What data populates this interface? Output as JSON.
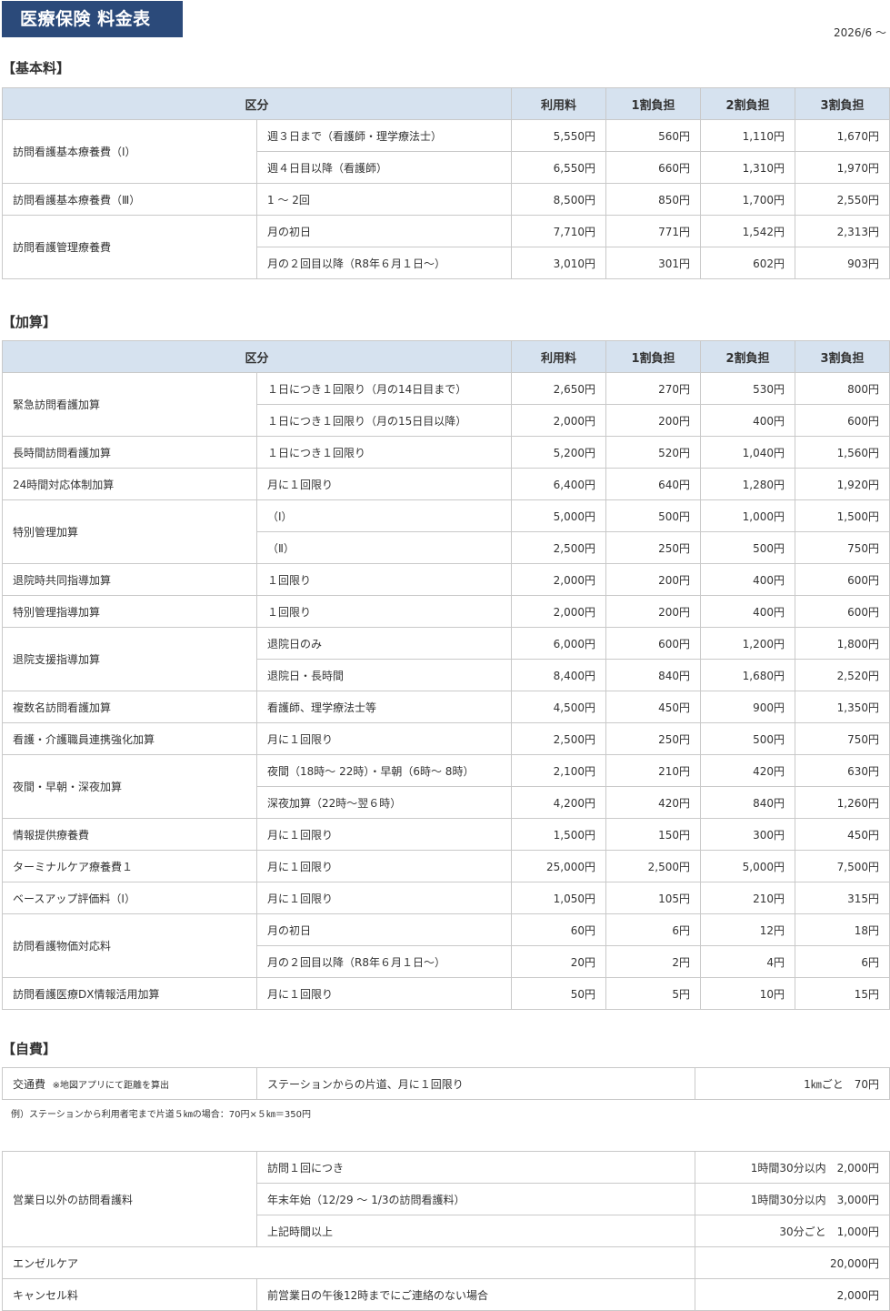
{
  "header": {
    "title": "医療保険 料金表",
    "date": "2026/6 〜"
  },
  "basic": {
    "section_title": "【基本料】",
    "headers": [
      "区分",
      "利用料",
      "1割負担",
      "2割負担",
      "3割負担"
    ],
    "groups": [
      {
        "name": "訪問看護基本療養費（Ⅰ）",
        "rows": [
          {
            "desc": "週３日まで（看護師・理学療法士）",
            "vals": [
              "5,550円",
              "560円",
              "1,110円",
              "1,670円"
            ]
          },
          {
            "desc": "週４日目以降（看護師）",
            "vals": [
              "6,550円",
              "660円",
              "1,310円",
              "1,970円"
            ]
          }
        ]
      },
      {
        "name": "訪問看護基本療養費（Ⅲ）",
        "rows": [
          {
            "desc": "1 〜 2回",
            "vals": [
              "8,500円",
              "850円",
              "1,700円",
              "2,550円"
            ]
          }
        ]
      },
      {
        "name": "訪問看護管理療養費",
        "rows": [
          {
            "desc": "月の初日",
            "vals": [
              "7,710円",
              "771円",
              "1,542円",
              "2,313円"
            ]
          },
          {
            "desc": "月の２回目以降（R8年６月１日〜）",
            "vals": [
              "3,010円",
              "301円",
              "602円",
              "903円"
            ]
          }
        ]
      }
    ]
  },
  "addition": {
    "section_title": "【加算】",
    "headers": [
      "区分",
      "利用料",
      "1割負担",
      "2割負担",
      "3割負担"
    ],
    "groups": [
      {
        "name": "緊急訪問看護加算",
        "rows": [
          {
            "desc": "１日につき１回限り（月の14日目まで）",
            "vals": [
              "2,650円",
              "270円",
              "530円",
              "800円"
            ]
          },
          {
            "desc": "１日につき１回限り（月の15日目以降）",
            "vals": [
              "2,000円",
              "200円",
              "400円",
              "600円"
            ]
          }
        ]
      },
      {
        "name": "長時間訪問看護加算",
        "rows": [
          {
            "desc": "１日につき１回限り",
            "vals": [
              "5,200円",
              "520円",
              "1,040円",
              "1,560円"
            ]
          }
        ]
      },
      {
        "name": "24時間対応体制加算",
        "rows": [
          {
            "desc": "月に１回限り",
            "vals": [
              "6,400円",
              "640円",
              "1,280円",
              "1,920円"
            ]
          }
        ]
      },
      {
        "name": "特別管理加算",
        "rows": [
          {
            "desc": "（Ⅰ）",
            "vals": [
              "5,000円",
              "500円",
              "1,000円",
              "1,500円"
            ]
          },
          {
            "desc": "（Ⅱ）",
            "vals": [
              "2,500円",
              "250円",
              "500円",
              "750円"
            ]
          }
        ]
      },
      {
        "name": "退院時共同指導加算",
        "rows": [
          {
            "desc": "１回限り",
            "vals": [
              "2,000円",
              "200円",
              "400円",
              "600円"
            ]
          }
        ]
      },
      {
        "name": "特別管理指導加算",
        "rows": [
          {
            "desc": "１回限り",
            "vals": [
              "2,000円",
              "200円",
              "400円",
              "600円"
            ]
          }
        ]
      },
      {
        "name": "退院支援指導加算",
        "rows": [
          {
            "desc": "退院日のみ",
            "vals": [
              "6,000円",
              "600円",
              "1,200円",
              "1,800円"
            ]
          },
          {
            "desc": "退院日・長時間",
            "vals": [
              "8,400円",
              "840円",
              "1,680円",
              "2,520円"
            ]
          }
        ]
      },
      {
        "name": "複数名訪問看護加算",
        "rows": [
          {
            "desc": "看護師、理学療法士等",
            "vals": [
              "4,500円",
              "450円",
              "900円",
              "1,350円"
            ]
          }
        ]
      },
      {
        "name": "看護・介護職員連携強化加算",
        "rows": [
          {
            "desc": "月に１回限り",
            "vals": [
              "2,500円",
              "250円",
              "500円",
              "750円"
            ]
          }
        ]
      },
      {
        "name": "夜間・早朝・深夜加算",
        "rows": [
          {
            "desc": "夜間（18時〜 22時）・早朝（6時〜 8時）",
            "vals": [
              "2,100円",
              "210円",
              "420円",
              "630円"
            ]
          },
          {
            "desc": "深夜加算（22時〜翌６時）",
            "vals": [
              "4,200円",
              "420円",
              "840円",
              "1,260円"
            ]
          }
        ]
      },
      {
        "name": "情報提供療養費",
        "rows": [
          {
            "desc": "月に１回限り",
            "vals": [
              "1,500円",
              "150円",
              "300円",
              "450円"
            ]
          }
        ]
      },
      {
        "name": "ターミナルケア療養費１",
        "rows": [
          {
            "desc": "月に１回限り",
            "vals": [
              "25,000円",
              "2,500円",
              "5,000円",
              "7,500円"
            ]
          }
        ]
      },
      {
        "name": "ベースアップ評価料（Ⅰ）",
        "rows": [
          {
            "desc": "月に１回限り",
            "vals": [
              "1,050円",
              "105円",
              "210円",
              "315円"
            ]
          }
        ]
      },
      {
        "name": "訪問看護物価対応料",
        "rows": [
          {
            "desc": "月の初日",
            "vals": [
              "60円",
              "6円",
              "12円",
              "18円"
            ]
          },
          {
            "desc": "月の２回目以降（R8年６月１日〜）",
            "vals": [
              "20円",
              "2円",
              "4円",
              "6円"
            ]
          }
        ]
      },
      {
        "name": "訪問看護医療DX情報活用加算",
        "rows": [
          {
            "desc": "月に１回限り",
            "vals": [
              "50円",
              "5円",
              "10円",
              "15円"
            ]
          }
        ]
      }
    ]
  },
  "self_pay": {
    "section_title": "【自費】",
    "transport": {
      "name": "交通費",
      "note": "※地図アプリにて距離を算出",
      "desc": "ステーションからの片道、月に１回限り",
      "price": "1㎞ごと　70円"
    },
    "example": "例）ステーションから利用者宅まで片道５㎞の場合：70円×５㎞＝350円",
    "off_hours": {
      "name": "営業日以外の訪問看護料",
      "rows": [
        {
          "desc": "訪問１回につき",
          "price": "1時間30分以内　2,000円"
        },
        {
          "desc": "年末年始（12/29 〜 1/3の訪問看護料）",
          "price": "1時間30分以内　3,000円"
        },
        {
          "desc": "上記時間以上",
          "price": "30分ごと　1,000円"
        }
      ]
    },
    "angel_care": {
      "name": "エンゼルケア",
      "price": "20,000円"
    },
    "cancel": {
      "name": "キャンセル料",
      "desc": "前営業日の午後12時までにご連絡のない場合",
      "price": "2,000円"
    }
  }
}
